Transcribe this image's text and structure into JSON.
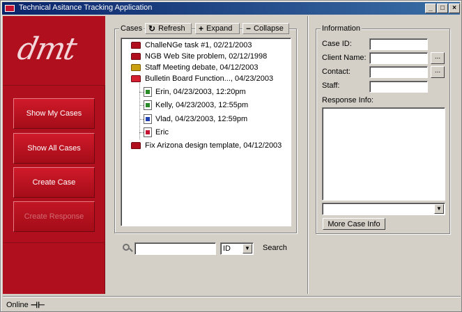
{
  "window": {
    "title": "Technical Asitance Tracking Application",
    "title_buttons": {
      "minimize": "_",
      "maximize": "□",
      "close": "×"
    }
  },
  "sidebar": {
    "logo_text": "dmt",
    "buttons": [
      {
        "label": "Show My Cases",
        "enabled": true
      },
      {
        "label": "Show All Cases",
        "enabled": true
      },
      {
        "label": "Create Case",
        "enabled": true
      },
      {
        "label": "Create Response",
        "enabled": false
      }
    ]
  },
  "cases": {
    "legend": "Cases",
    "toolbar": {
      "refresh": {
        "label": "Refresh",
        "icon": "refresh-icon"
      },
      "expand": {
        "label": "Expand",
        "icon": "plus-icon"
      },
      "collapse": {
        "label": "Collapse",
        "icon": "minus-icon"
      }
    },
    "tree": [
      {
        "label": "ChalleNGe task #1, 02/21/2003",
        "icon": "folder-icon"
      },
      {
        "label": "NGB Web Site problem, 02/12/1998",
        "icon": "folder-icon"
      },
      {
        "label": "Staff Meeting debate, 04/12/2003",
        "icon": "locked-folder-icon"
      },
      {
        "label": "Bulletin Board Function..., 04/23/2003",
        "icon": "open-folder-icon",
        "children": [
          {
            "label": "Erin, 04/23/2003, 12:20pm",
            "icon": "response-doc-icon"
          },
          {
            "label": "Kelly, 04/23/2003, 12:55pm",
            "icon": "response-doc-icon"
          },
          {
            "label": "Vlad, 04/23/2003, 12:59pm",
            "icon": "response-doc-icon"
          },
          {
            "label": "Eric",
            "icon": "draft-doc-icon"
          }
        ]
      },
      {
        "label": "Fix Arizona design template, 04/12/2003",
        "icon": "alert-folder-icon"
      }
    ]
  },
  "search": {
    "value": "",
    "field_selected": "ID",
    "label": "Search"
  },
  "information": {
    "legend": "Information",
    "fields": {
      "case_id": {
        "label": "Case ID:",
        "value": ""
      },
      "client_name": {
        "label": "Client Name:",
        "value": "",
        "browse": "..."
      },
      "contact": {
        "label": "Contact:",
        "value": "",
        "browse": "..."
      },
      "staff": {
        "label": "Staff:",
        "value": ""
      },
      "response_info": {
        "label": "Response Info:",
        "value": ""
      }
    },
    "response_select": "",
    "more_button": "More Case Info"
  },
  "statusbar": {
    "status": "Online"
  },
  "colors": {
    "brand_red": "#b0101e",
    "titlebar": "#0a246a",
    "face": "#d4d0c8"
  }
}
